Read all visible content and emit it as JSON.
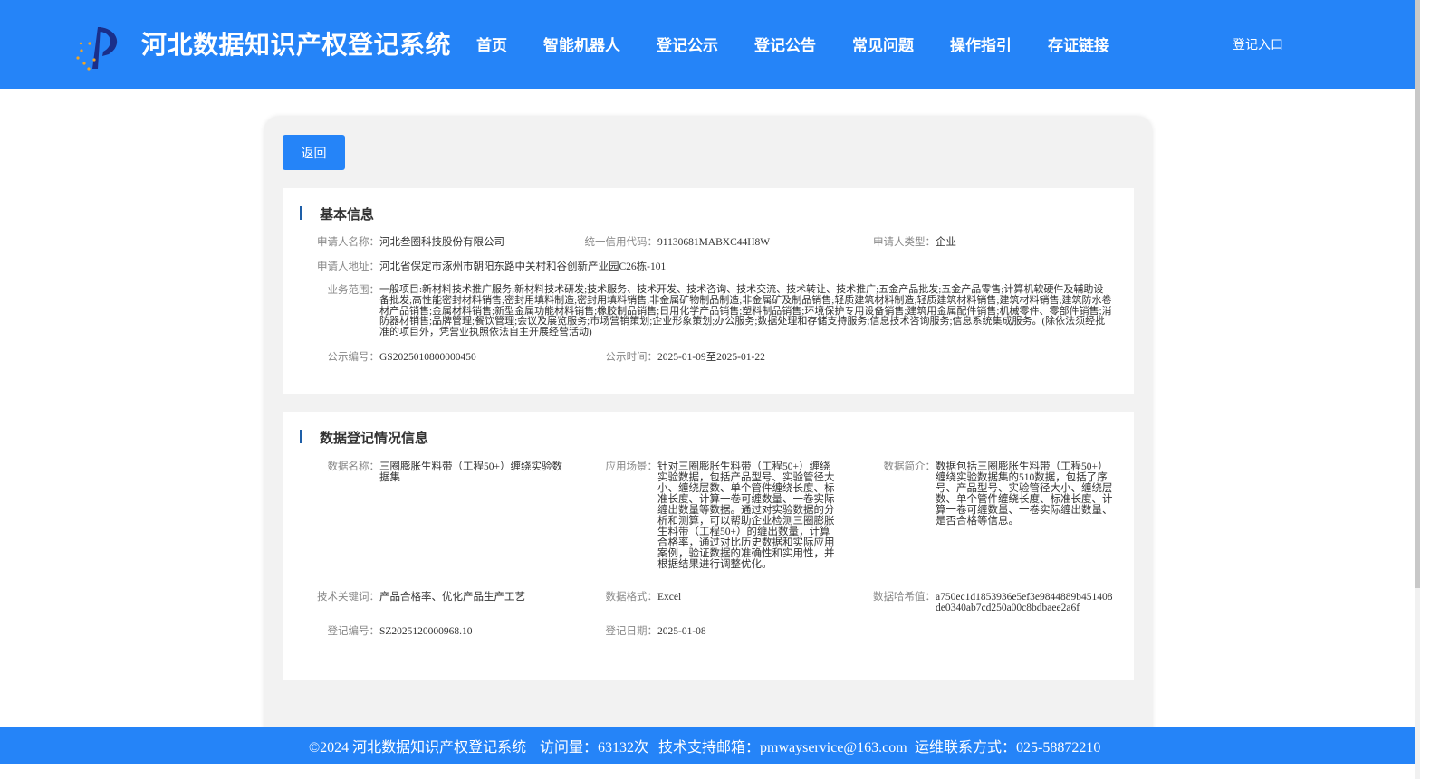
{
  "header": {
    "title": "河北数据知识产权登记系统",
    "nav": [
      "首页",
      "智能机器人",
      "登记公示",
      "登记公告",
      "常见问题",
      "操作指引",
      "存证链接"
    ],
    "login": "登记入口"
  },
  "colors": {
    "primary": "#2584f8",
    "title_bar": "#1e5fa8"
  },
  "back_button": "返回",
  "basic": {
    "title": "基本信息",
    "applicant_name_label": "申请人名称：",
    "applicant_name": "河北叁圈科技股份有限公司",
    "credit_code_label": "统一信用代码：",
    "credit_code": "91130681MABXC44H8W",
    "applicant_type_label": "申请人类型：",
    "applicant_type": "企业",
    "address_label": "申请人地址：",
    "address": "河北省保定市涿州市朝阳东路中关村和谷创新产业园C26栋-101",
    "scope_label": "业务范围：",
    "scope": "一般项目:新材料技术推广服务;新材料技术研发;技术服务、技术开发、技术咨询、技术交流、技术转让、技术推广;五金产品批发;五金产品零售;计算机软硬件及辅助设备批发;高性能密封材料销售;密封用填料制造;密封用填料销售;非金属矿物制品制造;非金属矿及制品销售;轻质建筑材料制造;轻质建筑材料销售;建筑材料销售;建筑防水卷材产品销售;金属材料销售;新型金属功能材料销售;橡胶制品销售;日用化学产品销售;塑料制品销售;环境保护专用设备销售;建筑用金属配件销售;机械零件、零部件销售;消防器材销售;品牌管理;餐饮管理;会议及展览服务;市场营销策划;企业形象策划;办公服务;数据处理和存储支持服务;信息技术咨询服务;信息系统集成服务。(除依法须经批准的项目外，凭营业执照依法自主开展经营活动)",
    "pub_no_label": "公示编号：",
    "pub_no": "GS2025010800000450",
    "pub_time_label": "公示时间：",
    "pub_time": "2025-01-09至2025-01-22"
  },
  "data_reg": {
    "title": "数据登记情况信息",
    "data_name_label": "数据名称：",
    "data_name": "三圈膨胀生料带（工程50+）缠绕实验数据集",
    "scenario_label": "应用场景：",
    "scenario": "针对三圈膨胀生料带（工程50+）缠绕实验数据，包括产品型号、实验管径大小、缠绕层数、单个管件缠绕长度、标准长度、计算一卷可缠数量、一卷实际缠出数量等数据。通过对实验数据的分析和测算，可以帮助企业检测三圈膨胀生料带（工程50+）的缠出数量，计算合格率，通过对比历史数据和实际应用案例，验证数据的准确性和实用性，并根据结果进行调整优化。",
    "intro_label": "数据简介：",
    "intro": "数据包括三圈膨胀生料带（工程50+）缠绕实验数据集的510数据，包括了序号、产品型号、实验管径大小、缠绕层数、单个管件缠绕长度、标准长度、计算一卷可缠数量、一卷实际缠出数量、是否合格等信息。",
    "keywords_label": "技术关键词：",
    "keywords": "产品合格率、优化产品生产工艺",
    "format_label": "数据格式：",
    "format": "Excel",
    "hash_label": "数据哈希值：",
    "hash": "a750ec1d1853936e5ef3e9844889b451408de0340ab7cd250a00c8bdbaee2a6f",
    "reg_no_label": "登记编号：",
    "reg_no": "SZ2025120000968.10",
    "reg_date_label": "登记日期：",
    "reg_date": "2025-01-08"
  },
  "footer": {
    "copyright": "©2024 河北数据知识产权登记系统",
    "visits": "访问量：63132次",
    "email": "技术支持邮箱：pmwayservice@163.com",
    "phone": "运维联系方式：025-58872210"
  }
}
